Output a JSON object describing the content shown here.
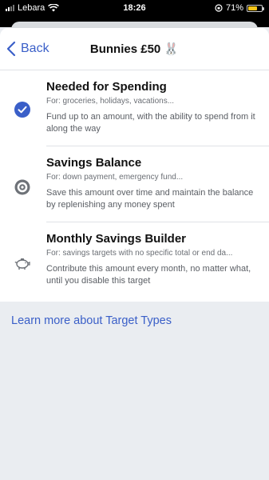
{
  "status_bar": {
    "carrier": "Lebara",
    "time": "18:26",
    "battery": "71%",
    "battery_fraction": 0.71
  },
  "nav": {
    "back_label": "Back",
    "title": "Bunnies £50 🐰"
  },
  "options": [
    {
      "icon": "checkmark-circle-icon",
      "title": "Needed for Spending",
      "subtitle": "For: groceries, holidays, vacations...",
      "description": "Fund up to an amount, with the ability to spend from it along the way",
      "selected": true
    },
    {
      "icon": "target-icon",
      "title": "Savings Balance",
      "subtitle": "For: down payment, emergency fund...",
      "description": "Save this amount over time and maintain the balance by replenishing any money spent",
      "selected": false
    },
    {
      "icon": "piggy-bank-icon",
      "title": "Monthly Savings Builder",
      "subtitle": "For: savings targets with no specific total or end da...",
      "description": "Contribute this amount every month, no matter what, until you disable this target",
      "selected": false
    }
  ],
  "learn_more_link": "Learn more about Target Types",
  "colors": {
    "accent": "#3a5fc8",
    "background": "#eaedf1",
    "icon_gray": "#6e7278"
  }
}
